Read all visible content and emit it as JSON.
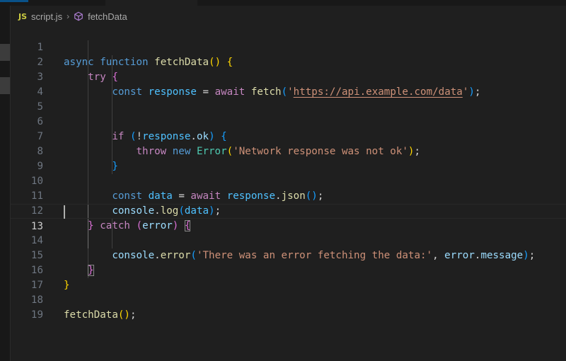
{
  "breadcrumb": {
    "file_badge": "JS",
    "file": "script.js",
    "separator": "›",
    "symbol_icon": "symbol-method-icon",
    "symbol": "fetchData"
  },
  "editor": {
    "current_line": 13,
    "line_numbers": [
      "1",
      "2",
      "3",
      "4",
      "5",
      "6",
      "7",
      "8",
      "9",
      "10",
      "11",
      "12",
      "13",
      "14",
      "15",
      "16",
      "17",
      "18",
      "19"
    ],
    "lines": [
      "async function fetchData() {",
      "    try {",
      "        const response = await fetch('https://api.example.com/data');",
      "",
      "",
      "        if (!response.ok) {",
      "            throw new Error('Network response was not ok');",
      "        }",
      "",
      "        const data = await response.json();",
      "        console.log(data);",
      "    } catch (error) {",
      "",
      "        console.error('There was an error fetching the data:', error.message);",
      "    }",
      "}",
      "",
      "fetchData();",
      ""
    ]
  },
  "colors": {
    "keyword": "#569cd6",
    "control": "#c586c0",
    "function": "#dcdcaa",
    "variable": "#9cdcfe",
    "constant": "#4fc1ff",
    "string": "#ce9178",
    "class": "#4ec9b0",
    "bracket_level1": "#ffd700",
    "bracket_level2": "#da70d6",
    "bracket_level3": "#179fff"
  }
}
